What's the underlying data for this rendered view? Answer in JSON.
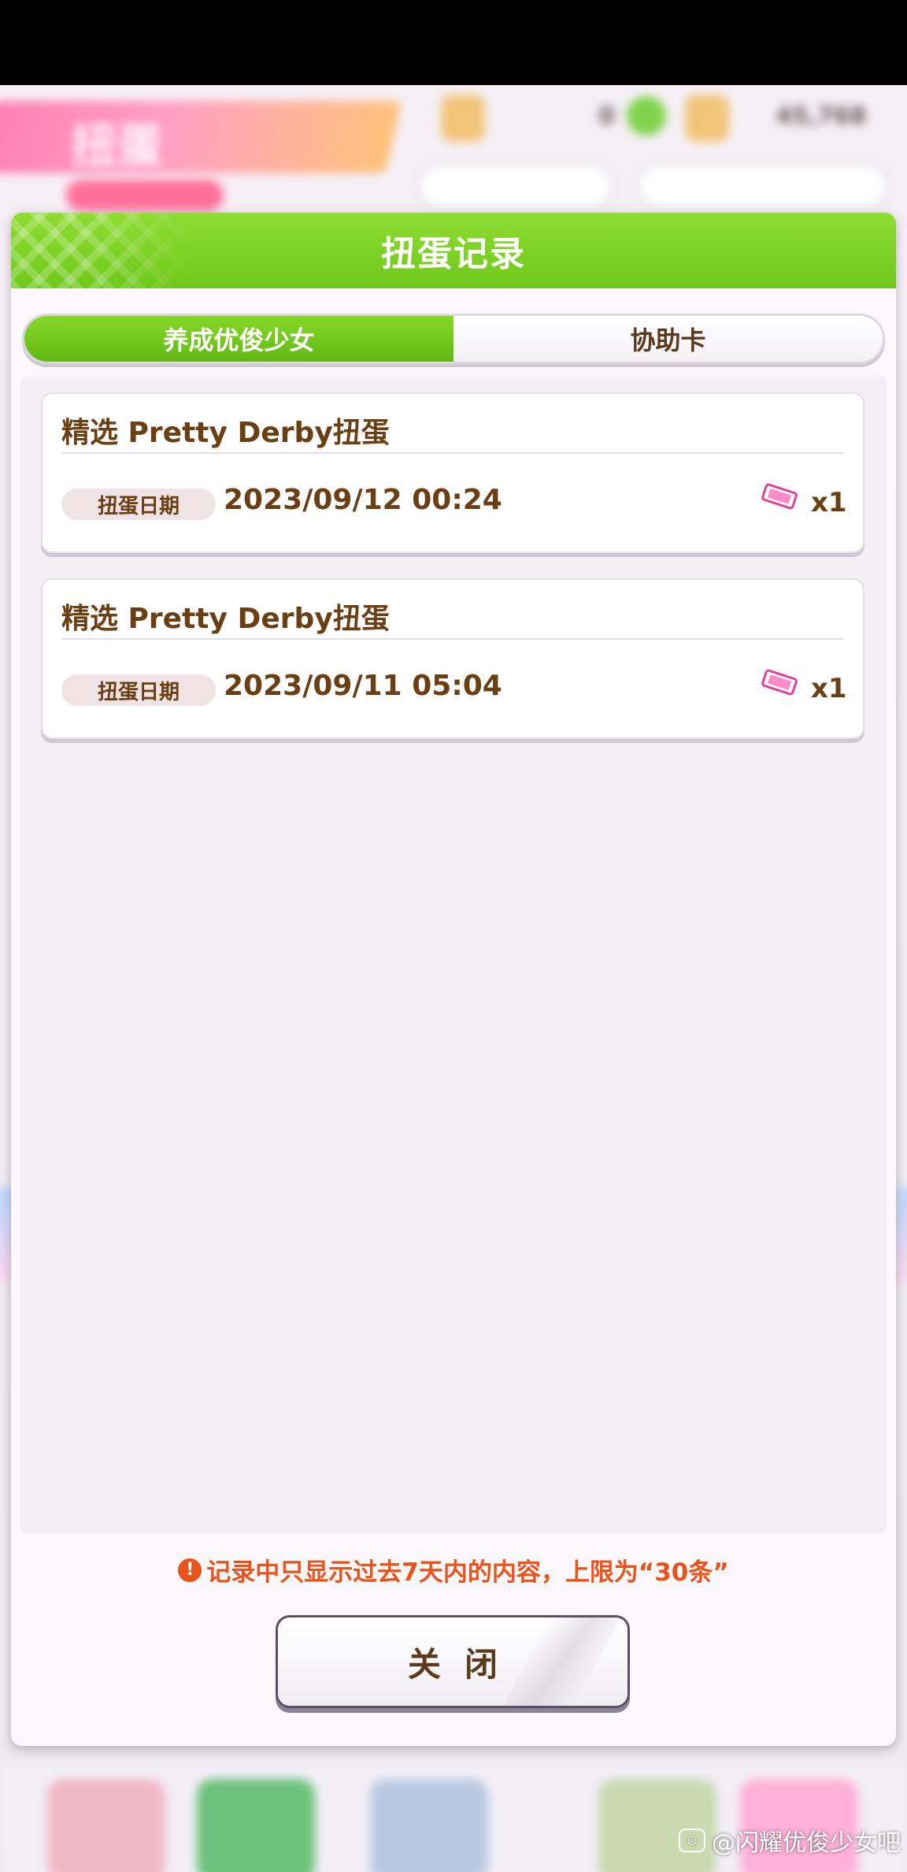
{
  "modal": {
    "title": "扭蛋记录",
    "tabs": [
      {
        "label": "养成优俊少女",
        "active": true
      },
      {
        "label": "协助卡",
        "active": false
      }
    ],
    "records": [
      {
        "title": "精选 Pretty Derby扭蛋",
        "date_label": "扭蛋日期",
        "date": "2023/09/12 00:24",
        "count": "x1",
        "icon": "ticket-icon"
      },
      {
        "title": "精选 Pretty Derby扭蛋",
        "date_label": "扭蛋日期",
        "date": "2023/09/11 05:04",
        "count": "x1",
        "icon": "ticket-icon"
      }
    ],
    "notice": "记录中只显示过去7天内的内容，上限为“30条”",
    "close_label": "关闭"
  },
  "background": {
    "title": "扭蛋",
    "currency_value": "0",
    "points_value": "45,768"
  },
  "watermark": "@闪耀优俊少女吧",
  "colors": {
    "header_green": "#6fc81b",
    "text_brown": "#6b3f14",
    "notice_orange": "#e8541c",
    "ticket_pink": "#ff5fa8"
  }
}
